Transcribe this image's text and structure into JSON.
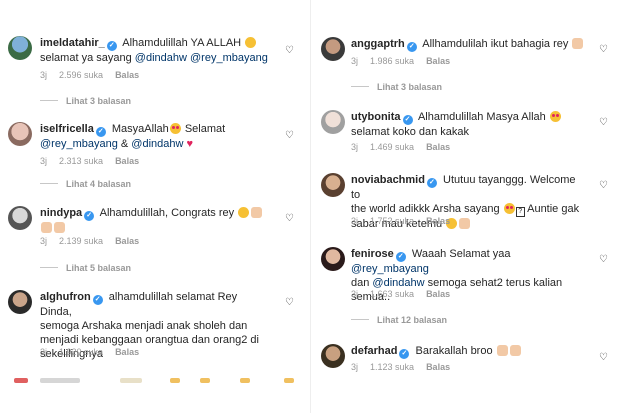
{
  "left": [
    {
      "user": "imeldatahir_",
      "text1": "Alhamdulillah YA ALLAH",
      "text2": "selamat ya sayang",
      "m1": "@dindahw",
      "m2": "@rey_mbayang",
      "time": "3j",
      "likes": "2.596 suka",
      "reply": "Balas",
      "replies": "Lihat 3 balasan"
    },
    {
      "user": "iselfricella",
      "text1": "MasyaAllah",
      "text1b": "Selamat",
      "m1": "@rey_mbayang",
      "amp": "&",
      "m2": "@dindahw",
      "time": "3j",
      "likes": "2.313 suka",
      "reply": "Balas",
      "replies": "Lihat 4 balasan"
    },
    {
      "user": "nindypa",
      "text1": "Alhamdulillah, Congrats rey",
      "time": "3j",
      "likes": "2.139 suka",
      "reply": "Balas",
      "replies": "Lihat 5 balasan"
    },
    {
      "user": "alghufron",
      "text1": "alhamdulillah selamat Rey Dinda,",
      "text2": "semoga Arshaka menjadi anak sholeh dan",
      "text3": "menjadi kebanggaan orangtua dan orang2 di",
      "text4": "sekelilingnya",
      "time": "3j",
      "likes": "1.920 suka",
      "reply": "Balas"
    }
  ],
  "right": [
    {
      "user": "anggaptrh",
      "text1": "Allhamdulilah ikut bahagia rey",
      "time": "3j",
      "likes": "1.986 suka",
      "reply": "Balas",
      "replies": "Lihat 3 balasan"
    },
    {
      "user": "utybonita",
      "text1": "Alhamdulillah Masya Allah",
      "text2": "selamat koko dan kakak",
      "time": "3j",
      "likes": "1.469 suka",
      "reply": "Balas"
    },
    {
      "user": "noviabachmid",
      "text1": "Ututuu tayanggg. Welcome to",
      "text2": "the world adikkk Arsha sayang",
      "text2b": "Auntie gak",
      "text3": "sabar mau ketemu",
      "time": "3j",
      "likes": "1.752 suka",
      "reply": "Balas"
    },
    {
      "user": "fenirose",
      "text1": "Waaah Selamat yaa",
      "m1": "@rey_mbayang",
      "text2a": "dan",
      "m2": "@dindahw",
      "text2": "semoga sehat2 terus kalian",
      "text3": "semua..",
      "time": "3j",
      "likes": "1.663 suka",
      "reply": "Balas",
      "replies": "Lihat 12 balasan"
    },
    {
      "user": "defarhad",
      "text1": "Barakallah broo",
      "time": "3j",
      "likes": "1.123 suka",
      "reply": "Balas"
    }
  ],
  "colors": {
    "verified": "#3897f0",
    "mention": "#003569",
    "muted": "#999999"
  },
  "icons": {
    "like": "heart-outline-icon",
    "verified": "verified-badge-icon"
  }
}
